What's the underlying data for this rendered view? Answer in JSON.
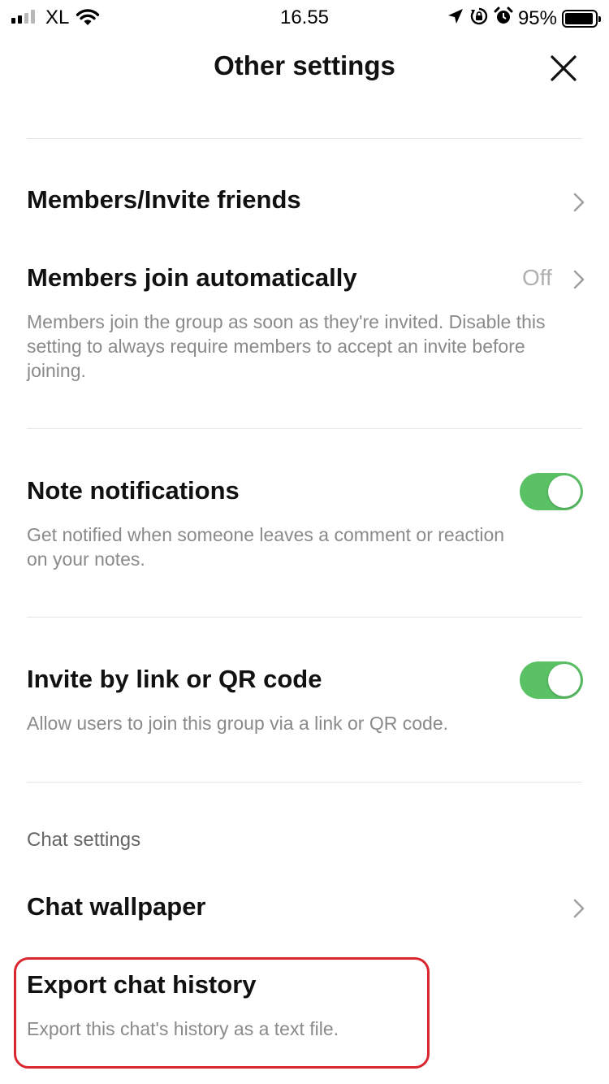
{
  "status_bar": {
    "carrier": "XL",
    "time": "16.55",
    "battery_percent": "95%",
    "battery_level": 0.95,
    "icons": [
      "signal-icon",
      "wifi-icon",
      "location-arrow-icon",
      "orientation-lock-icon",
      "alarm-icon",
      "battery-icon"
    ]
  },
  "header": {
    "title": "Other settings",
    "close_icon": "close-icon"
  },
  "settings": {
    "members_invite": {
      "label": "Members/Invite friends"
    },
    "members_join": {
      "label": "Members join automatically",
      "value": "Off",
      "description": "Members join the group as soon as they're invited. Disable this setting to always require members to accept an invite before joining."
    },
    "note_notifications": {
      "label": "Note notifications",
      "enabled": true,
      "description": "Get notified when someone leaves a comment or reaction on your notes."
    },
    "invite_link": {
      "label": "Invite by link or QR code",
      "enabled": true,
      "description": "Allow users to join this group via a link or QR code."
    }
  },
  "chat_settings": {
    "section_label": "Chat settings",
    "wallpaper": {
      "label": "Chat wallpaper"
    },
    "export": {
      "label": "Export chat history",
      "description": "Export this chat's history as a text file."
    }
  },
  "colors": {
    "toggle_on": "#5ac265",
    "highlight_border": "#d9262f",
    "secondary_text": "#8a8a8a"
  }
}
